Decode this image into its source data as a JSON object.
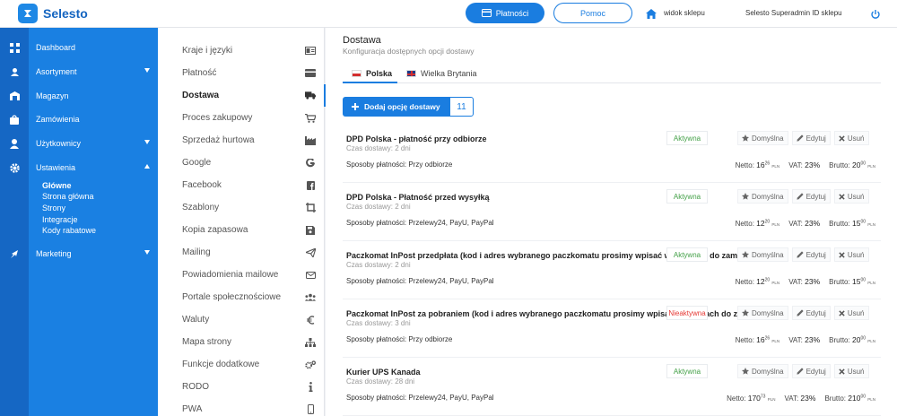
{
  "app": {
    "brand": "Selesto",
    "payments_label": "Płatności",
    "help_label": "Pomoc",
    "shop_view_label": "widok sklepu",
    "admin_label": "Selesto Superadmin  ID sklepu"
  },
  "sidebar": {
    "items": [
      {
        "label": "Dashboard",
        "icon": "dashboard-icon"
      },
      {
        "label": "Asortyment",
        "icon": "assortment-icon",
        "caret": "down"
      },
      {
        "label": "Magazyn",
        "icon": "warehouse-icon"
      },
      {
        "label": "Zamówienia",
        "icon": "orders-icon"
      },
      {
        "label": "Użytkownicy",
        "icon": "users-icon",
        "caret": "down"
      },
      {
        "label": "Ustawienia",
        "icon": "settings-icon",
        "caret": "up"
      },
      {
        "label": "Marketing",
        "icon": "marketing-icon",
        "caret": "down"
      }
    ],
    "sub_items": [
      "Główne",
      "Strona główna",
      "Strony",
      "Integracje",
      "Kody rabatowe"
    ]
  },
  "settings_menu": {
    "items": [
      {
        "label": "Kraje i języki",
        "icon": "language-icon"
      },
      {
        "label": "Płatność",
        "icon": "credit-card-icon"
      },
      {
        "label": "Dostawa",
        "icon": "truck-icon"
      },
      {
        "label": "Proces zakupowy",
        "icon": "cart-icon"
      },
      {
        "label": "Sprzedaż hurtowa",
        "icon": "industry-icon"
      },
      {
        "label": "Google",
        "icon": "google-icon"
      },
      {
        "label": "Facebook",
        "icon": "facebook-icon"
      },
      {
        "label": "Szablony",
        "icon": "template-icon"
      },
      {
        "label": "Kopia zapasowa",
        "icon": "save-icon"
      },
      {
        "label": "Mailing",
        "icon": "paper-plane-icon"
      },
      {
        "label": "Powiadomienia mailowe",
        "icon": "envelope-icon"
      },
      {
        "label": "Portale społecznościowe",
        "icon": "social-users-icon"
      },
      {
        "label": "Waluty",
        "icon": "euro-icon"
      },
      {
        "label": "Mapa strony",
        "icon": "sitemap-icon"
      },
      {
        "label": "Funkcje dodatkowe",
        "icon": "gears-icon"
      },
      {
        "label": "RODO",
        "icon": "info-icon"
      },
      {
        "label": "PWA",
        "icon": "mobile-icon"
      }
    ]
  },
  "main": {
    "title": "Dostawa",
    "subtitle": "Konfiguracja dostępnych opcji dostawy",
    "tabs": [
      {
        "label": "Polska",
        "flag": "pl"
      },
      {
        "label": "Wielka Brytania",
        "flag": "uk"
      }
    ],
    "add_button_label": "Dodaj opcję dostawy",
    "option_count": "11",
    "labels": {
      "default": "Domyślna",
      "edit": "Edytuj",
      "delete": "Usuń",
      "time_prefix": "Czas dostawy:",
      "payments_prefix": "Sposoby płatności:",
      "net": "Netto:",
      "vat": "VAT:",
      "gross": "Brutto:",
      "currency": "PLN"
    },
    "options": [
      {
        "name": "DPD Polska - płatność przy odbiorze",
        "time": "2 dni",
        "payments": "Przy odbiorze",
        "status": "Aktywna",
        "active": true,
        "net_int": "16",
        "net_dec": "26",
        "vat": "23%",
        "gross_int": "20",
        "gross_dec": "00"
      },
      {
        "name": "DPD Polska - Płatność przed wysyłką",
        "time": "2 dni",
        "payments": "Przelewy24, PayU, PayPal",
        "status": "Aktywna",
        "active": true,
        "net_int": "12",
        "net_dec": "20",
        "vat": "23%",
        "gross_int": "15",
        "gross_dec": "00"
      },
      {
        "name": "Paczkomat InPost przedpłata (kod i adres wybranego paczkomatu prosimy wpisać w uwagach do zamówienia)",
        "time": "2 dni",
        "payments": "Przelewy24, PayU, PayPal",
        "status": "Aktywna",
        "active": true,
        "net_int": "12",
        "net_dec": "20",
        "vat": "23%",
        "gross_int": "15",
        "gross_dec": "00"
      },
      {
        "name": "Paczkomat InPost za pobraniem (kod i adres wybranego paczkomatu prosimy wpisać w uwagach do zamówienia)",
        "time": "3 dni",
        "payments": "Przy odbiorze",
        "status": "Nieaktywna",
        "active": false,
        "net_int": "16",
        "net_dec": "26",
        "vat": "23%",
        "gross_int": "20",
        "gross_dec": "00"
      },
      {
        "name": "Kurier UPS Kanada",
        "time": "28 dni",
        "payments": "Przelewy24, PayU, PayPal",
        "status": "Aktywna",
        "active": true,
        "net_int": "170",
        "net_dec": "73",
        "vat": "23%",
        "gross_int": "210",
        "gross_dec": "00"
      }
    ]
  },
  "colors": {
    "primary": "#1a7de0",
    "sidebar": "#1a80e2",
    "sidebar_icons": "#1567c4",
    "active_status": "#43a047",
    "inactive_status": "#e53935"
  }
}
